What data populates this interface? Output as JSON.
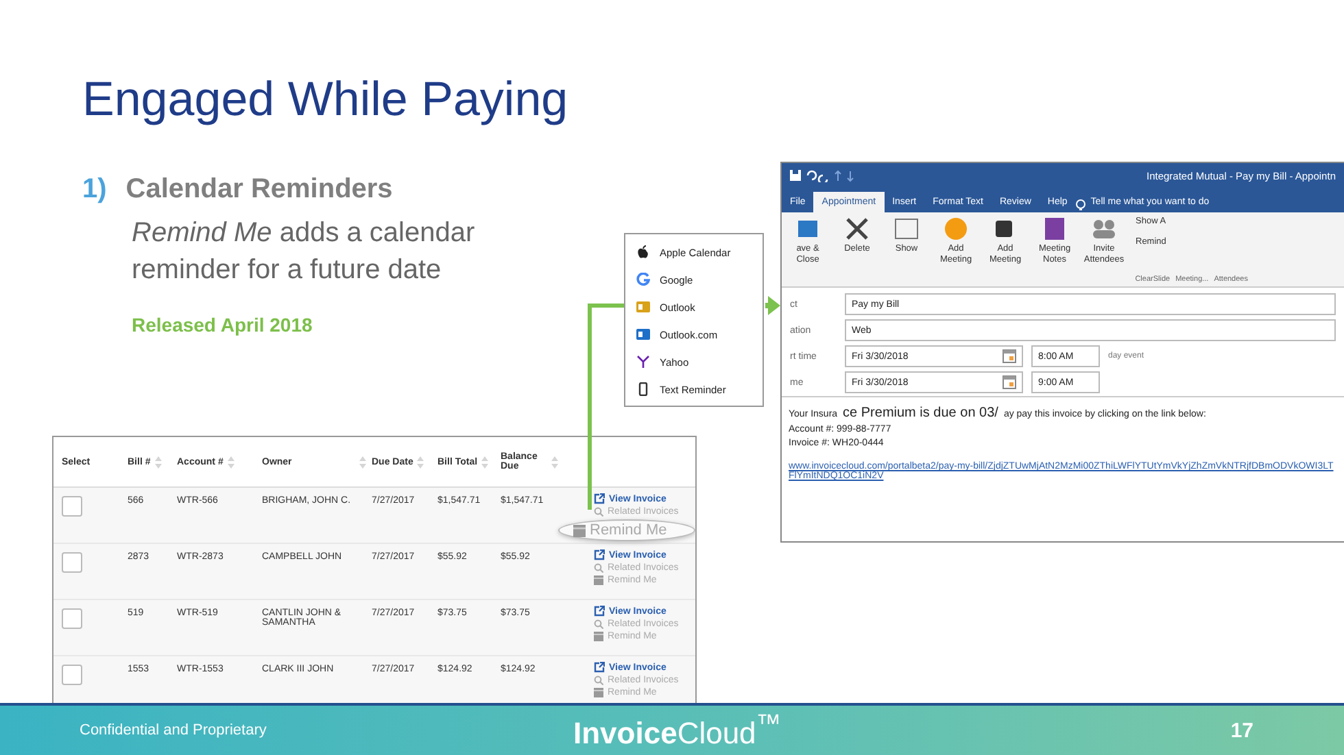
{
  "slide": {
    "title": "Engaged While Paying",
    "bullet": {
      "number": "1)",
      "heading": "Calendar Reminders",
      "text": "*Remind Me* adds a calendar reminder for a future date",
      "note": "Released April 2018"
    }
  },
  "table": {
    "columns": [
      "Select",
      "Bill #",
      "Account #",
      "Owner",
      "Due Date",
      "Bill Total",
      "Balance Due"
    ],
    "rows": [
      {
        "checked": false,
        "bill": "566",
        "account": "WTR-566",
        "owner": "BRIGHAM, JOHN C.",
        "due_date": "7/27/2017",
        "bill_total": "$1,547.71",
        "balance_due": "$1,547.71",
        "actions": [
          "View Invoice",
          "Related Invoices",
          "Remind Me"
        ],
        "highlighted": true
      },
      {
        "checked": false,
        "bill": "2873",
        "account": "WTR-2873",
        "owner": "CAMPBELL JOHN",
        "due_date": "7/27/2017",
        "bill_total": "$55.92",
        "balance_due": "$55.92",
        "actions": [
          "View Invoice",
          "Related Invoices",
          "Remind Me"
        ],
        "highlighted": false
      },
      {
        "checked": false,
        "bill": "519",
        "account": "WTR-519",
        "owner": "CANTLIN JOHN & SAMANTHA",
        "due_date": "7/27/2017",
        "bill_total": "$73.75",
        "balance_due": "$73.75",
        "actions": [
          "View Invoice",
          "Related Invoices",
          "Remind Me"
        ],
        "highlighted": false
      },
      {
        "checked": false,
        "bill": "1553",
        "account": "WTR-1553",
        "owner": "CLARK III JOHN",
        "due_date": "7/27/2017",
        "bill_total": "$124.92",
        "balance_due": "$124.92",
        "actions": [
          "View Invoice",
          "Related Invoices",
          "Remind Me"
        ],
        "highlighted": false
      }
    ]
  },
  "calendar_menu": {
    "items": [
      "Apple Calendar",
      "Google",
      "Outlook",
      "Outlook.com",
      "Yahoo",
      "Text Reminder"
    ]
  },
  "outlook": {
    "title": "Integrated Mutual - Pay my Bill - Appointn",
    "tabs": [
      {
        "label": "File",
        "selected": false
      },
      {
        "label": "Appointment",
        "selected": true
      },
      {
        "label": "Insert",
        "selected": false
      },
      {
        "label": "Format Text",
        "selected": false
      },
      {
        "label": "Review",
        "selected": false
      },
      {
        "label": "Help",
        "selected": false
      }
    ],
    "tell_me": "Tell me what you want to do",
    "ribbon": [
      "ave & Close",
      "Delete",
      "Show",
      "Add Meeting",
      "Add Meeting",
      "Meeting Notes",
      "Invite Attendees"
    ],
    "ribbon_small": [
      "Show A",
      "Remind"
    ],
    "groups": [
      "ClearSlide",
      "Meeting...",
      "Attendees"
    ],
    "fields": [
      {
        "label": "ct",
        "value": "Pay my Bill"
      },
      {
        "label": "ation",
        "value": "Web"
      },
      {
        "label": "rt time",
        "value": "Fri 3/30/2018",
        "time": "8:00 AM"
      },
      {
        "label": "me",
        "value": "Fri 3/30/2018",
        "time": "9:00 AM"
      }
    ],
    "all_day": "day event",
    "body": {
      "line_start": "Your Insura",
      "line_zoom": "ce Premium is due on 03/",
      "line_end": "ay pay this invoice by clicking on the link below:",
      "account": "Account #: 999-88-7777",
      "invoice": "Invoice #: WH20-0444",
      "link": "www.invoicecloud.com/portalbeta2/pay-my-bill/ZjdjZTUwMjAtN2MzMi00ZThiLWFlYTUtYmVkYjZhZmVkNTRjfDBmODVkOWI3LTFlYmItNDQ1OC1iN2V"
    }
  },
  "footer": {
    "left": "Confidential and Proprietary",
    "logo": "**Invoice**Cloud$^{™}$",
    "page": "17"
  }
}
